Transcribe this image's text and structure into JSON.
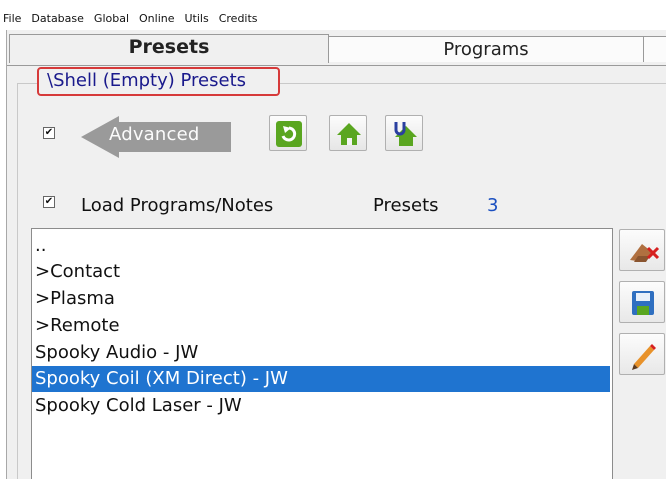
{
  "menu": [
    "File",
    "Database",
    "Global",
    "Online",
    "Utils",
    "Credits"
  ],
  "tabs": {
    "presets": "Presets",
    "programs": "Programs"
  },
  "group": {
    "title": "\\Shell (Empty) Presets"
  },
  "advanced": {
    "label": "Advanced",
    "checked_glyph": "✔"
  },
  "load": {
    "label": "Load Programs/Notes",
    "checked_glyph": "✔"
  },
  "presets_counter": {
    "label": "Presets",
    "count": "3"
  },
  "list": {
    "rows": [
      "..",
      ">Contact",
      ">Plasma",
      ">Remote",
      "Spooky Audio - JW",
      "Spooky Coil (XM Direct) - JW",
      "Spooky Cold Laser - JW"
    ],
    "selected_index": 5
  },
  "icons": {
    "refresh": "refresh-icon",
    "home": "home-icon",
    "home_sync": "home-sync-icon",
    "delete": "delete-icon",
    "save": "save-icon",
    "edit": "edit-icon"
  },
  "colors": {
    "selection": "#1f74d0",
    "legend_border": "#d63a3a",
    "count": "#1a4fc0",
    "icon_green": "#5aa620"
  }
}
